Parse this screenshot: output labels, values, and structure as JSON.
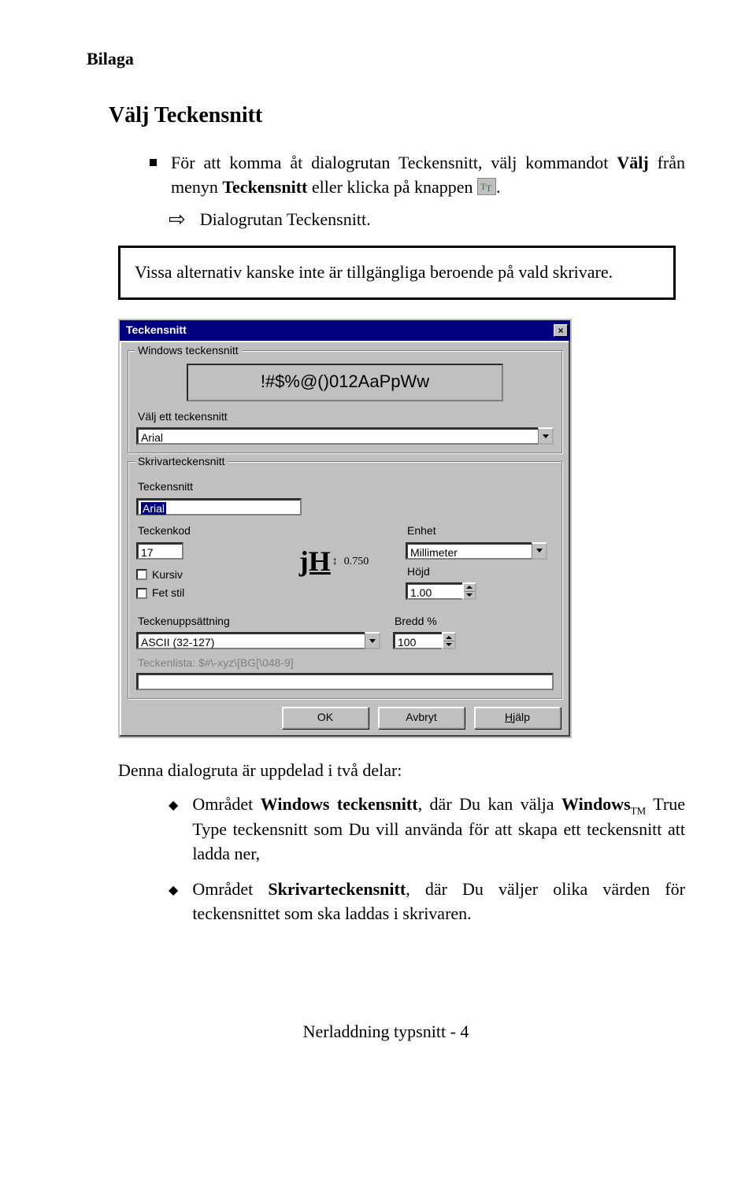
{
  "runningHead": "Bilaga",
  "heading": "Välj Teckensnitt",
  "intro": {
    "prefix": "För att komma åt dialogrutan Teckensnitt, välj kommandot ",
    "cmd": "Välj",
    "mid": " från menyn ",
    "menu": "Teckensnitt",
    "tail": " eller klicka på knappen "
  },
  "resultText": "Dialogrutan Teckensnitt.",
  "noteText": "Vissa alternativ kanske inte är tillgängliga beroende på vald skrivare.",
  "dialog": {
    "title": "Teckensnitt",
    "group1": {
      "legend": "Windows teckensnitt",
      "preview": "!#$%@()012AaPpWw",
      "selectLabel": "Välj ett teckensnitt",
      "fontValue": "Arial"
    },
    "group2": {
      "legend": "Skrivarteckensnitt",
      "fontLabel": "Teckensnitt",
      "fontValue": "Arial",
      "codeLabel": "Teckenkod",
      "codeValue": "17",
      "italicLabel": "Kursiv",
      "boldLabel": "Fet stil",
      "jhValue": "0.750",
      "unitLabel": "Enhet",
      "unitValue": "Millimeter",
      "heightLabel": "Höjd",
      "heightValue": "1.00",
      "widthLabel": "Bredd %",
      "widthValue": "100",
      "charsetLabel": "Teckenuppsättning",
      "charsetValue": "ASCII (32-127)",
      "listLabel": "Teckenlista: $#\\-xyz\\[BG[\\048-9]"
    },
    "buttons": {
      "ok": "OK",
      "cancel": "Avbryt",
      "helpPrefix": "H",
      "helpRest": "jälp"
    }
  },
  "afterIntro": "Denna dialogruta är uppdelad i två delar:",
  "bullet1": {
    "p1": "Området ",
    "b1": "Windows teckensnitt",
    "p2": ", där Du kan välja ",
    "b2": "Windows",
    "tm": "TM",
    "p3": " True Type teckensnitt som Du vill använda för att skapa ett teckensnitt att ladda ner,"
  },
  "bullet2": {
    "p1": "Området ",
    "b1": "Skrivarteckensnitt",
    "p2": ", där Du väljer olika värden för teckensnittet som ska laddas i skrivaren."
  },
  "footer": "Nerladdning typsnitt - 4"
}
